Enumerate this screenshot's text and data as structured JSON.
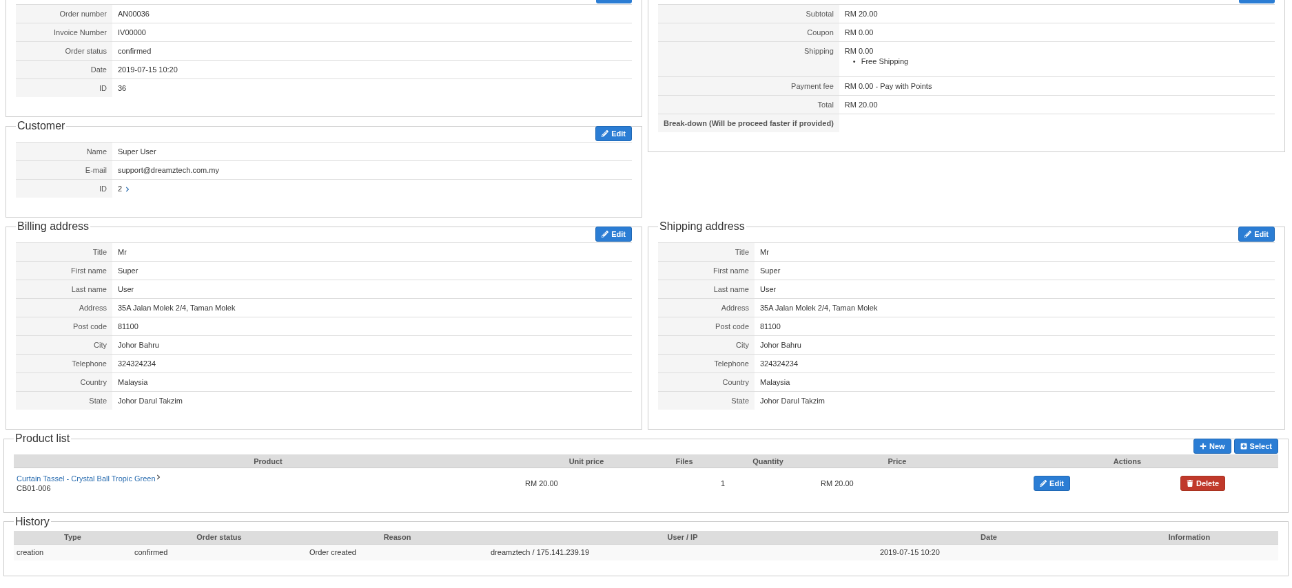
{
  "order": {
    "rows": [
      {
        "label": "Order number",
        "value": "AN00036"
      },
      {
        "label": "Invoice Number",
        "value": "IV00000"
      },
      {
        "label": "Order status",
        "value": "confirmed"
      },
      {
        "label": "Date",
        "value": "2019-07-15 10:20"
      },
      {
        "label": "ID",
        "value": "36"
      }
    ]
  },
  "totals": {
    "rows": [
      {
        "label": "Subtotal",
        "value": "RM 20.00",
        "bold": false
      },
      {
        "label": "Coupon",
        "value": "RM 0.00",
        "bold": false
      },
      {
        "label": "Shipping",
        "value": "RM 0.00",
        "items": [
          {
            "bullet": "•",
            "text": "Free Shipping"
          }
        ],
        "bold": false
      },
      {
        "label": "Payment fee",
        "value": "RM 0.00 - Pay with Points",
        "bold": false
      },
      {
        "label": "Total",
        "value": "RM 20.00",
        "bold": false
      },
      {
        "label": "Break-down (Will be proceed faster if provided)",
        "bold": true
      }
    ]
  },
  "customer": {
    "title": "Customer",
    "edit_button": "Edit",
    "rows": [
      {
        "label": "Name",
        "value": "Super User",
        "link": false
      },
      {
        "label": "E-mail",
        "value": "support@dreamztech.com.my",
        "link": false
      },
      {
        "label": "ID",
        "value": "2",
        "link": true
      }
    ]
  },
  "billing_address": {
    "title": "Billing address",
    "edit_button": "Edit",
    "rows": [
      {
        "label": "Title",
        "value": "Mr"
      },
      {
        "label": "First name",
        "value": "Super"
      },
      {
        "label": "Last name",
        "value": "User"
      },
      {
        "label": "Address",
        "value": "35A Jalan Molek 2/4, Taman Molek"
      },
      {
        "label": "Post code",
        "value": "81100"
      },
      {
        "label": "City",
        "value": "Johor Bahru"
      },
      {
        "label": "Telephone",
        "value": "324324234"
      },
      {
        "label": "Country",
        "value": "Malaysia"
      },
      {
        "label": "State",
        "value": "Johor Darul Takzim"
      }
    ]
  },
  "shipping_address": {
    "title": "Shipping address",
    "edit_button": "Edit",
    "rows": [
      {
        "label": "Title",
        "value": "Mr"
      },
      {
        "label": "First name",
        "value": "Super"
      },
      {
        "label": "Last name",
        "value": "User"
      },
      {
        "label": "Address",
        "value": "35A Jalan Molek 2/4, Taman Molek"
      },
      {
        "label": "Post code",
        "value": "81100"
      },
      {
        "label": "City",
        "value": "Johor Bahru"
      },
      {
        "label": "Telephone",
        "value": "324324234"
      },
      {
        "label": "Country",
        "value": "Malaysia"
      },
      {
        "label": "State",
        "value": "Johor Darul Takzim"
      }
    ]
  },
  "product_list": {
    "title": "Product list",
    "buttons": [
      {
        "kind": "new",
        "label": "New"
      },
      {
        "kind": "select",
        "label": "Select"
      }
    ],
    "columns": [
      "Product",
      "Unit price",
      "Files",
      "Quantity",
      "Price",
      "Actions"
    ],
    "rows": [
      {
        "product": "Curtain Tassel - Crystal Ball Tropic Green",
        "code": "CB01-006",
        "unit_price": "RM 20.00",
        "quantity": "1",
        "price": "RM 20.00",
        "edit_button": "Edit",
        "delete_button": "Delete"
      }
    ]
  },
  "history": {
    "title": "History",
    "columns": [
      "Type",
      "Order status",
      "Reason",
      "User / IP",
      "Date",
      "Information"
    ],
    "rows": [
      {
        "type": "creation",
        "order_status": "confirmed",
        "reason": "Order created",
        "user_ip": "dreamztech / 175.141.239.19",
        "date": "2019-07-15 10:20"
      }
    ]
  }
}
